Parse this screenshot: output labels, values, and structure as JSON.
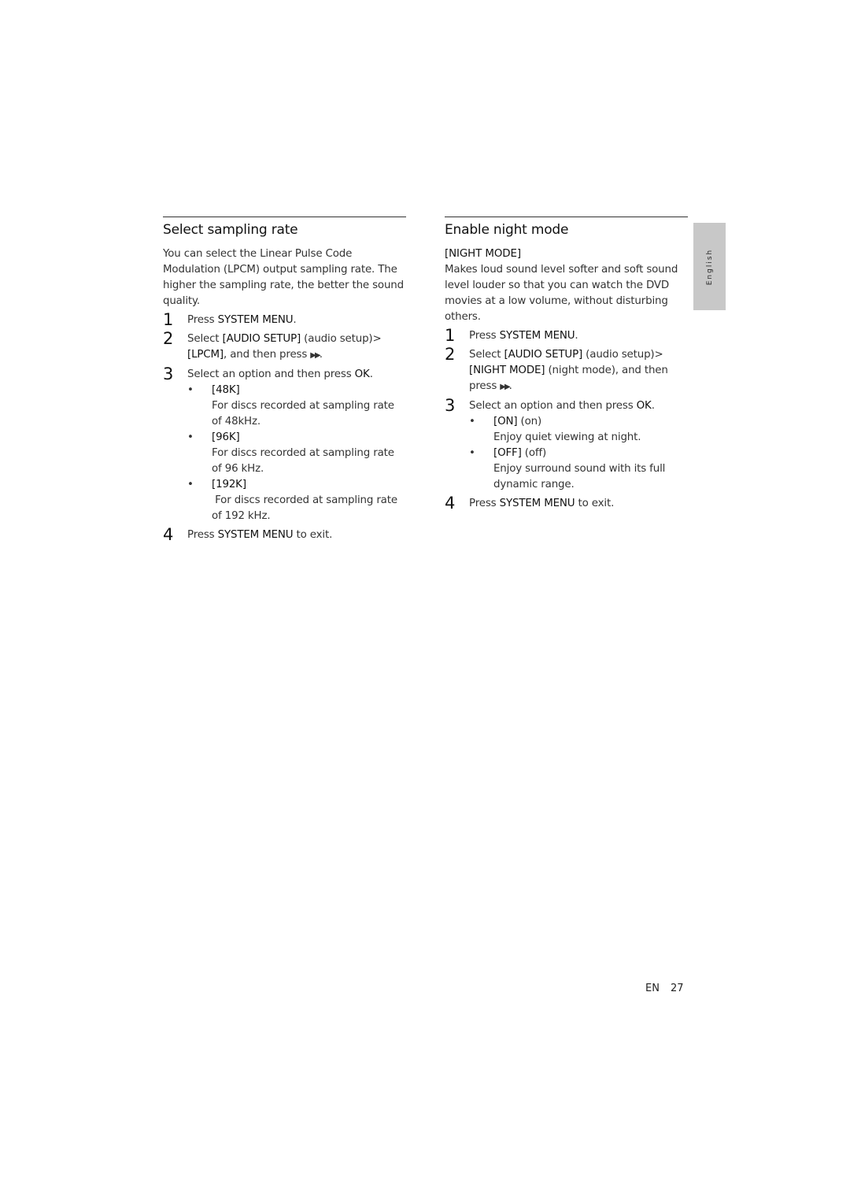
{
  "left_section": {
    "title": "Select sampling rate",
    "intro": "You can select the Linear Pulse Code Modulation (LPCM) output sampling rate. The higher the sampling rate, the better the sound quality.",
    "steps": [
      {
        "num": "1",
        "pre": "Press ",
        "kw": "SYSTEM MENU",
        "post": "."
      },
      {
        "num": "2",
        "pre": "Select ",
        "kw": "[AUDIO SETUP]",
        "mid": " (audio setup)>",
        "kw2": "[LPCM]",
        "post": ", and then press ",
        "icon": "▶▶",
        "end": "."
      },
      {
        "num": "3",
        "pre": "Select an option and then press ",
        "kw": "OK",
        "post": "."
      },
      {
        "num": "4",
        "pre": "Press ",
        "kw": "SYSTEM MENU",
        "post": " to exit."
      }
    ],
    "options": [
      {
        "bullet": "•",
        "label": "[48K]",
        "desc": "For discs recorded at sampling rate of 48kHz."
      },
      {
        "bullet": "•",
        "label": "[96K]",
        "desc": "For discs recorded at sampling rate of 96 kHz."
      },
      {
        "bullet": "•",
        "label": "[192K]",
        "desc": " For discs recorded at sampling rate of 192 kHz."
      }
    ]
  },
  "right_section": {
    "title": "Enable night mode",
    "label": "[NIGHT MODE]",
    "intro": "Makes loud sound level softer and soft sound level louder so that you can watch the DVD movies at a low volume, without disturbing others.",
    "steps": [
      {
        "num": "1",
        "pre": "Press ",
        "kw": "SYSTEM MENU",
        "post": "."
      },
      {
        "num": "2",
        "pre": "Select ",
        "kw": "[AUDIO SETUP]",
        "mid": " (audio setup)>",
        "kw2": "[NIGHT MODE]",
        "post": " (night mode), and then press ",
        "icon": "▶▶",
        "end": "."
      },
      {
        "num": "3",
        "pre": "Select an option and then press ",
        "kw": "OK",
        "post": "."
      },
      {
        "num": "4",
        "pre": "Press ",
        "kw": "SYSTEM MENU",
        "post": " to exit."
      }
    ],
    "options": [
      {
        "bullet": "•",
        "label": "[ON]",
        "suffix": " (on)",
        "desc": "Enjoy quiet viewing at night."
      },
      {
        "bullet": "•",
        "label": "[OFF]",
        "suffix": " (off)",
        "desc": "Enjoy surround sound with its full dynamic range."
      }
    ]
  },
  "side_tab": {
    "label": "English"
  },
  "footer": {
    "lang": "EN",
    "page": "27"
  }
}
